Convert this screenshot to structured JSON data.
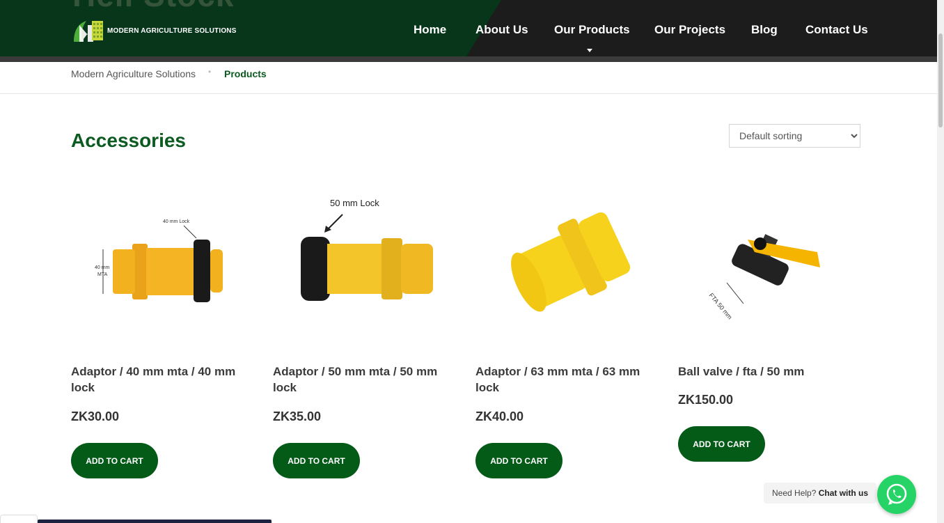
{
  "header": {
    "hero_text": "Hell Stock",
    "logo_text": "MODERN AGRICULTURE SOLUTIONS",
    "nav": [
      {
        "label": "Home"
      },
      {
        "label": "About Us"
      },
      {
        "label": "Our Products"
      },
      {
        "label": "Our Projects"
      },
      {
        "label": "Blog"
      },
      {
        "label": "Contact Us"
      }
    ]
  },
  "breadcrumb": {
    "home": "Modern Agriculture Solutions",
    "separator": "•",
    "current": "Products"
  },
  "page_title": "Accessories",
  "sort": {
    "selected": "Default sorting",
    "options": [
      "Default sorting"
    ]
  },
  "products": [
    {
      "name": "Adaptor / 40 mm mta / 40 mm lock",
      "price": "ZK30.00",
      "button": "ADD TO CART",
      "image_labels": {
        "lock": "40 mm Lock",
        "mta": "40 mm\nMTA"
      }
    },
    {
      "name": "Adaptor / 50 mm mta / 50 mm lock",
      "price": "ZK35.00",
      "button": "ADD TO CART",
      "image_labels": {
        "lock": "50 mm Lock"
      }
    },
    {
      "name": "Adaptor / 63 mm mta / 63 mm lock",
      "price": "ZK40.00",
      "button": "ADD TO CART",
      "image_labels": {}
    },
    {
      "name": "Ball valve / fta / 50 mm",
      "price": "ZK150.00",
      "button": "ADD TO CART",
      "image_labels": {
        "fta": "FTA 50 mm"
      }
    }
  ],
  "chat": {
    "prefix": "Need Help?",
    "cta": "Chat with us",
    "icon": "whatsapp-icon"
  },
  "colors": {
    "brand_green": "#0b5a1f",
    "button_green": "#045a17",
    "header_bg": "#07361a",
    "whatsapp": "#25d366"
  }
}
